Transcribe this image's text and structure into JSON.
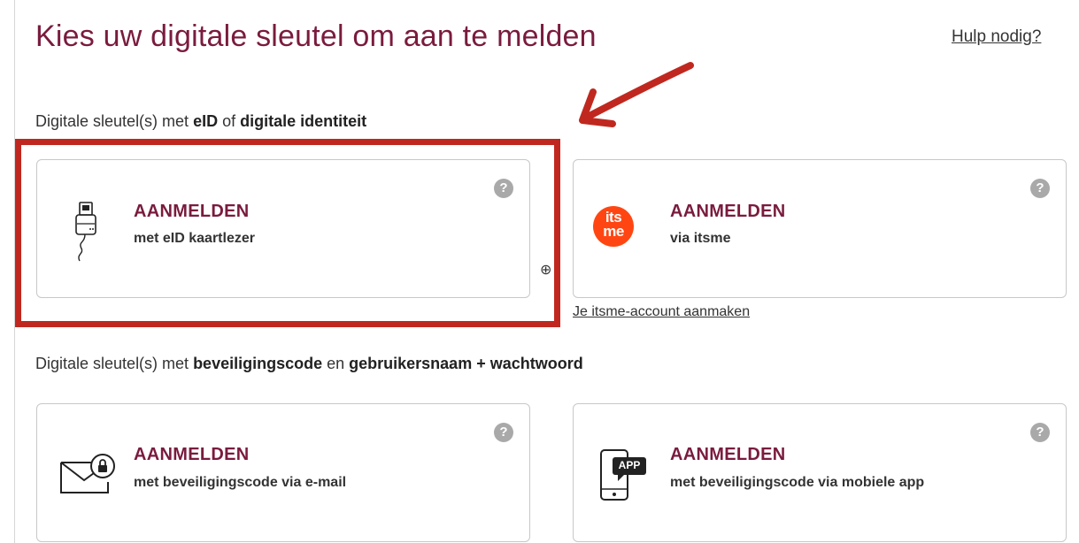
{
  "page": {
    "title": "Kies uw digitale sleutel om aan te melden",
    "help_link": "Hulp nodig?"
  },
  "section1": {
    "prefix": "Digitale sleutel(s) met ",
    "bold1": "eID",
    "middle": " of ",
    "bold2": "digitale identiteit"
  },
  "section2": {
    "prefix": "Digitale sleutel(s) met ",
    "bold1": "beveiligingscode",
    "middle": " en ",
    "bold2": "gebruikersnaam + wachtwoord"
  },
  "cards": [
    {
      "cta": "AANMELDEN",
      "sub": "met eID kaartlezer",
      "icon": "card-reader-icon"
    },
    {
      "cta": "AANMELDEN",
      "sub": "via itsme",
      "icon": "itsme-logo-icon"
    },
    {
      "cta": "AANMELDEN",
      "sub": "met beveiligingscode via e-mail",
      "icon": "envelope-lock-icon"
    },
    {
      "cta": "AANMELDEN",
      "sub": "met beveiligingscode via mobiele app",
      "icon": "mobile-app-icon"
    }
  ],
  "help_icon_glyph": "?",
  "itsme_account_link": "Je itsme-account aanmaken",
  "itsme_logo": {
    "line1": "its",
    "line2": "me",
    "color": "#ff4612"
  },
  "app_badge": "APP",
  "crosshair_glyph": "⊕",
  "colors": {
    "brand": "#7a1b3e",
    "annotation_red": "#c0281f",
    "help_gray": "#a9a9a9"
  }
}
